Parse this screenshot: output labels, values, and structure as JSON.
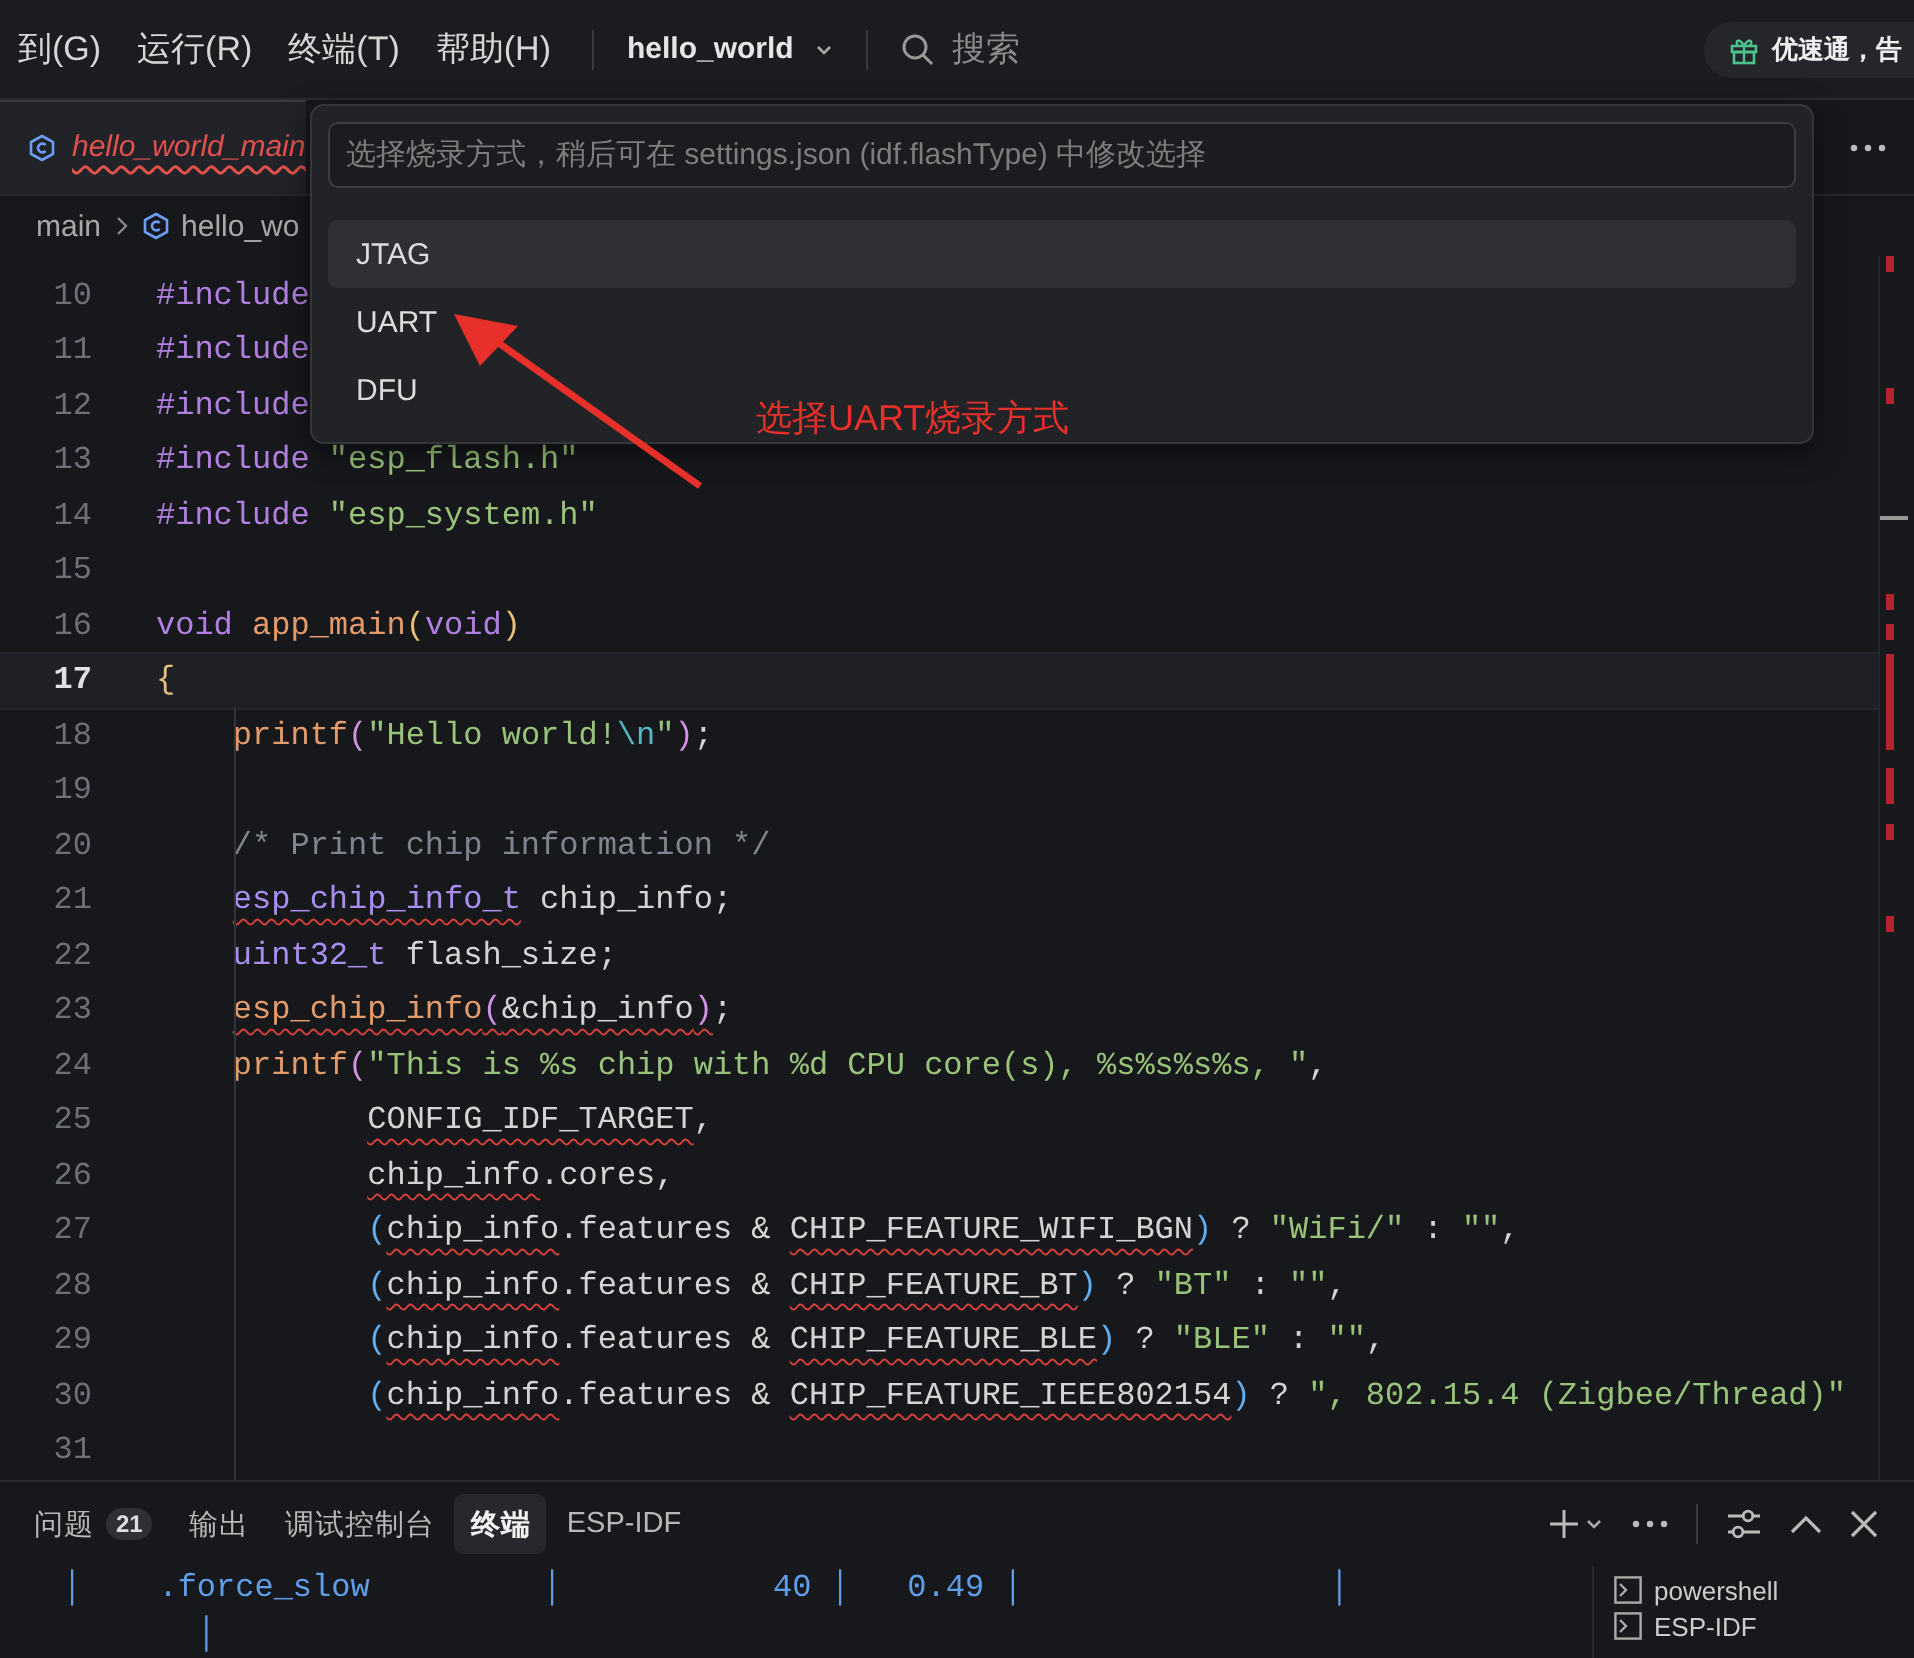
{
  "menu_bar": {
    "menus": [
      "到(G)",
      "运行(R)",
      "终端(T)",
      "帮助(H)"
    ],
    "project": "hello_world",
    "search": {
      "placeholder": "搜索"
    },
    "promo": "优速通，告"
  },
  "editor_tabs": [
    {
      "label": "hello_world_main",
      "selected": true,
      "error": true
    }
  ],
  "breadcrumb": [
    "main",
    "hello_wo"
  ],
  "code": {
    "lines": [
      {
        "number": "10",
        "current": false,
        "kind": "top",
        "tokens": [
          {
            "kind": "kw",
            "text": "#include"
          }
        ]
      },
      {
        "number": "11",
        "current": false,
        "kind": "top",
        "tokens": [
          {
            "kind": "kw",
            "text": "#include"
          }
        ]
      },
      {
        "number": "12",
        "current": false,
        "kind": "top",
        "tokens": [
          {
            "kind": "kw",
            "text": "#include"
          }
        ]
      },
      {
        "number": "13",
        "current": false,
        "kind": "top",
        "tokens": [
          {
            "kind": "kw",
            "text": "#include "
          },
          {
            "kind": "str",
            "text": "\"esp_flash.h\""
          }
        ]
      },
      {
        "number": "14",
        "current": false,
        "kind": "top",
        "tokens": [
          {
            "kind": "kw",
            "text": "#include "
          },
          {
            "kind": "str",
            "text": "\"esp_system.h\""
          }
        ]
      },
      {
        "number": "15",
        "current": false,
        "kind": "top"
      },
      {
        "number": "16",
        "current": false,
        "kind": "top",
        "tokens": [
          {
            "kind": "kw",
            "text": "void "
          },
          {
            "kind": "fn",
            "text": "app_main"
          },
          {
            "kind": "b1",
            "text": "("
          },
          {
            "kind": "kw",
            "text": "void"
          },
          {
            "kind": "b1",
            "text": ")"
          }
        ]
      },
      {
        "number": "17",
        "current": true,
        "kind": "top",
        "tokens": [
          {
            "kind": "b1",
            "text": "{"
          }
        ]
      },
      {
        "number": "18",
        "current": false,
        "kind": "block",
        "tokens": [
          {
            "kind": "fn",
            "text": "printf"
          },
          {
            "kind": "b2",
            "text": "("
          },
          {
            "kind": "str",
            "text": "\"Hello world!"
          },
          {
            "kind": "esc",
            "text": "\\n"
          },
          {
            "kind": "str",
            "text": "\""
          },
          {
            "kind": "b2",
            "text": ")"
          },
          {
            "kind": "plain",
            "text": ";"
          }
        ]
      },
      {
        "number": "19",
        "current": false,
        "kind": "block"
      },
      {
        "number": "20",
        "current": false,
        "kind": "block",
        "tokens": [
          {
            "kind": "comment",
            "text": "/* Print chip information */"
          }
        ]
      },
      {
        "number": "21",
        "current": false,
        "kind": "block",
        "tokens": [
          {
            "kind": "type",
            "text": "esp_chip_info_t",
            "squiggle": true
          },
          {
            "kind": "plain",
            "text": " chip_info;"
          }
        ]
      },
      {
        "number": "22",
        "current": false,
        "kind": "block",
        "tokens": [
          {
            "kind": "type",
            "text": "uint32_t"
          },
          {
            "kind": "plain",
            "text": " flash_size;"
          }
        ]
      },
      {
        "number": "23",
        "current": false,
        "kind": "block",
        "tokens": [
          {
            "kind": "fn",
            "text": "esp_chip_info",
            "squiggle": true
          },
          {
            "kind": "b2",
            "text": "(",
            "squiggle": true
          },
          {
            "kind": "plain",
            "text": "&chip_info",
            "squiggle": true
          },
          {
            "kind": "b2",
            "text": ")",
            "squiggle": true
          },
          {
            "kind": "plain",
            "text": ";"
          }
        ]
      },
      {
        "number": "24",
        "current": false,
        "kind": "block",
        "tokens": [
          {
            "kind": "fn",
            "text": "printf"
          },
          {
            "kind": "b2",
            "text": "("
          },
          {
            "kind": "str",
            "text": "\"This is %s chip with %d CPU core(s), %s%s%s%s, \""
          },
          {
            "kind": "plain",
            "text": ","
          }
        ]
      },
      {
        "number": "25",
        "current": false,
        "kind": "wrap",
        "tokens": [
          {
            "kind": "macro",
            "text": "CONFIG_IDF_TARGET",
            "squiggle": true
          },
          {
            "kind": "plain",
            "text": ","
          }
        ]
      },
      {
        "number": "26",
        "current": false,
        "kind": "wrap",
        "tokens": [
          {
            "kind": "plain",
            "text": "chip_info",
            "squiggle": true
          },
          {
            "kind": "plain",
            "text": ".cores,"
          }
        ]
      },
      {
        "number": "27",
        "current": false,
        "kind": "wrap",
        "tokens": [
          {
            "kind": "b3",
            "text": "("
          },
          {
            "kind": "plain",
            "text": "chip_info",
            "squiggle": true
          },
          {
            "kind": "plain",
            "text": ".features & "
          },
          {
            "kind": "macro",
            "text": "CHIP_FEATURE_WIFI_BGN",
            "squiggle": true
          },
          {
            "kind": "b3",
            "text": ")"
          },
          {
            "kind": "plain",
            "text": " ? "
          },
          {
            "kind": "str",
            "text": "\"WiFi/\""
          },
          {
            "kind": "plain",
            "text": " : "
          },
          {
            "kind": "str",
            "text": "\"\""
          },
          {
            "kind": "plain",
            "text": ","
          }
        ]
      },
      {
        "number": "28",
        "current": false,
        "kind": "wrap",
        "tokens": [
          {
            "kind": "b3",
            "text": "("
          },
          {
            "kind": "plain",
            "text": "chip_info",
            "squiggle": true
          },
          {
            "kind": "plain",
            "text": ".features & "
          },
          {
            "kind": "macro",
            "text": "CHIP_FEATURE_BT",
            "squiggle": true
          },
          {
            "kind": "b3",
            "text": ")"
          },
          {
            "kind": "plain",
            "text": " ? "
          },
          {
            "kind": "str",
            "text": "\"BT\""
          },
          {
            "kind": "plain",
            "text": " : "
          },
          {
            "kind": "str",
            "text": "\"\""
          },
          {
            "kind": "plain",
            "text": ","
          }
        ]
      },
      {
        "number": "29",
        "current": false,
        "kind": "wrap",
        "tokens": [
          {
            "kind": "b3",
            "text": "("
          },
          {
            "kind": "plain",
            "text": "chip_info",
            "squiggle": true
          },
          {
            "kind": "plain",
            "text": ".features & "
          },
          {
            "kind": "macro",
            "text": "CHIP_FEATURE_BLE",
            "squiggle": true
          },
          {
            "kind": "b3",
            "text": ")"
          },
          {
            "kind": "plain",
            "text": " ? "
          },
          {
            "kind": "str",
            "text": "\"BLE\""
          },
          {
            "kind": "plain",
            "text": " : "
          },
          {
            "kind": "str",
            "text": "\"\""
          },
          {
            "kind": "plain",
            "text": ","
          }
        ]
      },
      {
        "number": "30",
        "current": false,
        "kind": "wrap",
        "tokens": [
          {
            "kind": "b3",
            "text": "("
          },
          {
            "kind": "plain",
            "text": "chip_info",
            "squiggle": true
          },
          {
            "kind": "plain",
            "text": ".features & "
          },
          {
            "kind": "macro",
            "text": "CHIP_FEATURE_IEEE802154",
            "squiggle": true
          },
          {
            "kind": "b3",
            "text": ")"
          },
          {
            "kind": "plain",
            "text": " ? "
          },
          {
            "kind": "str",
            "text": "\", 802.15.4 (Zigbee/Thread)\""
          }
        ]
      },
      {
        "number": "31",
        "current": false,
        "kind": "block"
      }
    ]
  },
  "quick_pick": {
    "placeholder": "选择烧录方式，稍后可在 settings.json (idf.flashType) 中修改选择",
    "items": [
      {
        "label": "JTAG",
        "selected": true
      },
      {
        "label": "UART",
        "selected": false
      },
      {
        "label": "DFU",
        "selected": false
      }
    ]
  },
  "annotation": {
    "text": "选择UART烧录方式",
    "color": "#e8302a"
  },
  "panel": {
    "tabs": [
      {
        "label": "问题",
        "badge": "21",
        "selected": false
      },
      {
        "label": "输出",
        "selected": false
      },
      {
        "label": "调试控制台",
        "selected": false
      },
      {
        "label": "终端",
        "selected": true
      },
      {
        "label": "ESP-IDF",
        "selected": false
      }
    ],
    "terminal_lines": [
      "  │    .force_slow         │           40 │   0.49 │                │",
      "         │"
    ],
    "terminals": [
      "powershell",
      "ESP-IDF"
    ]
  }
}
